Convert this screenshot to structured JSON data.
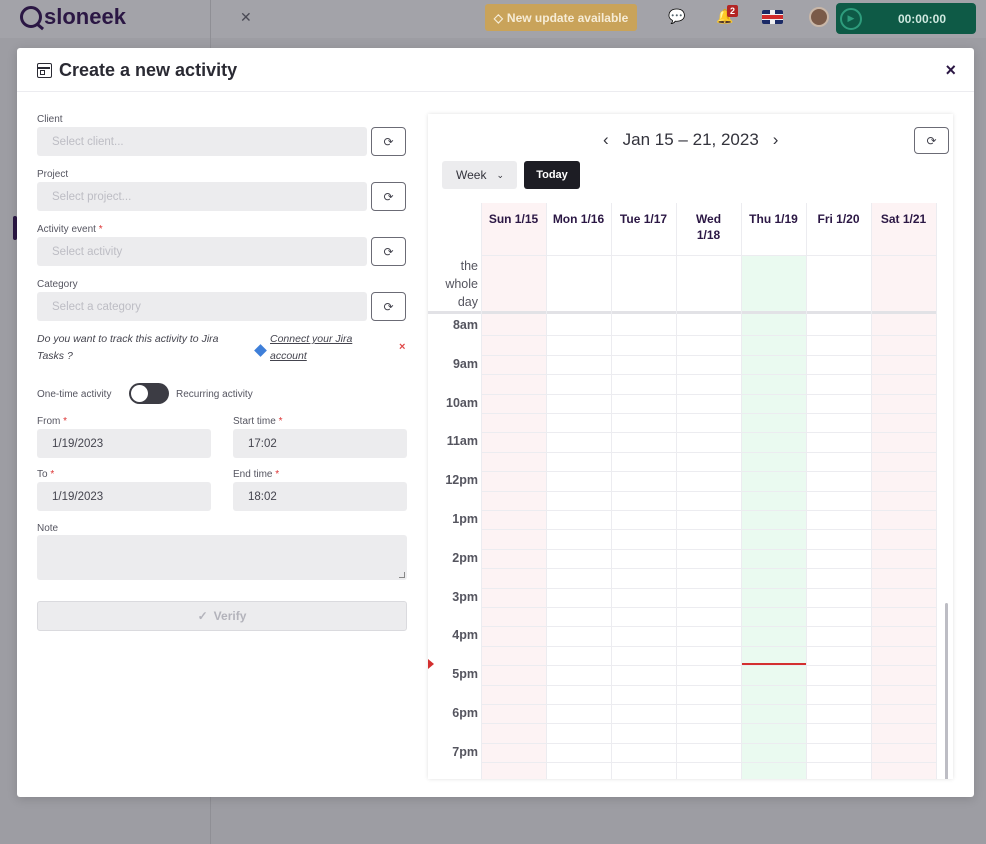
{
  "app": {
    "logo_text": "sloneek",
    "update_label": "New update available",
    "notif_count": "2",
    "timer": "00:00:00"
  },
  "modal": {
    "title": "Create a new activity",
    "close": "×"
  },
  "form": {
    "client_label": "Client",
    "client_placeholder": "Select client...",
    "project_label": "Project",
    "project_placeholder": "Select project...",
    "activity_label": "Activity event",
    "activity_placeholder": "Select activity",
    "category_label": "Category",
    "category_placeholder": "Select a category",
    "required_mark": "*",
    "jira_question_1": "Do you want to track this activity to Jira",
    "jira_question_2": "Tasks ?",
    "jira_link_1": "Connect your Jira",
    "jira_link_2": "account",
    "jira_dismiss": "×",
    "one_time_label": "One-time activity",
    "recurring_label": "Recurring activity",
    "from_label": "From",
    "from_value": "1/19/2023",
    "start_label": "Start time",
    "start_value": "17:02",
    "to_label": "To",
    "to_value": "1/19/2023",
    "end_label": "End time",
    "end_value": "18:02",
    "note_label": "Note",
    "verify_label": "Verify"
  },
  "calendar": {
    "range": "Jan 15 – 21, 2023",
    "view": "Week",
    "today_label": "Today",
    "allday_label": "the whole day",
    "days": [
      "Sun 1/15",
      "Mon 1/16",
      "Tue 1/17",
      "Wed 1/18",
      "Thu 1/19",
      "Fri 1/20",
      "Sat 1/21"
    ],
    "hours": [
      "8am",
      "9am",
      "10am",
      "11am",
      "12pm",
      "1pm",
      "2pm",
      "3pm",
      "4pm",
      "5pm",
      "6pm",
      "7pm"
    ],
    "today_index": 4,
    "weekend_color": "#fdf3f4",
    "today_color": "#eafaf0"
  }
}
